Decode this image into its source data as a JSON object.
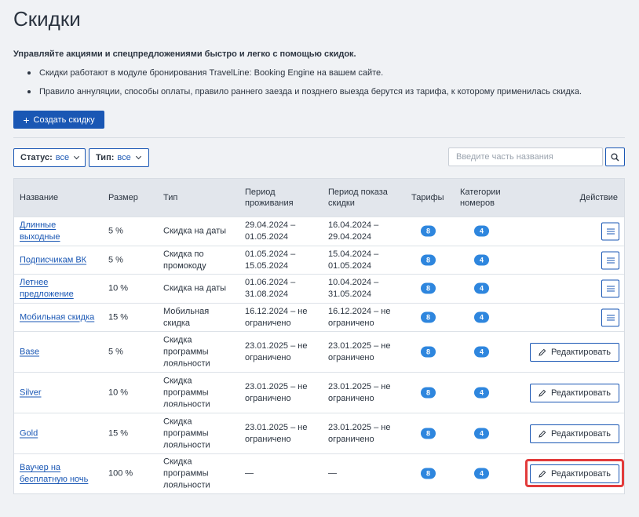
{
  "page": {
    "title": "Скидки",
    "intro": "Управляйте акциями и спецпредложениями быстро и легко с помощью скидок.",
    "bullets": [
      "Скидки работают в модуле бронирования TravelLine: Booking Engine на вашем сайте.",
      "Правило аннуляции, способы оплаты, правило раннего заезда и позднего выезда берутся из тарифа, к которому применилась скидка."
    ],
    "create_button": "Создать скидку"
  },
  "filters": {
    "status_label": "Статус:",
    "status_value": "все",
    "type_label": "Тип:",
    "type_value": "все",
    "search_placeholder": "Введите часть названия"
  },
  "table": {
    "headers": {
      "name": "Название",
      "size": "Размер",
      "type": "Тип",
      "stay_1": "Период",
      "stay_2": "проживания",
      "show_1": "Период показа",
      "show_2": "скидки",
      "rates": "Тарифы",
      "cats_1": "Категории",
      "cats_2": "номеров",
      "action": "Действие"
    },
    "edit_label": "Редактировать",
    "rows": [
      {
        "name_1": "Длинные",
        "name_2": "выходные",
        "size": "5 %",
        "type_1": "Скидка на даты",
        "type_2": "",
        "type_3": "",
        "stay_1": "29.04.2024 –",
        "stay_2": "01.05.2024",
        "show_1": "16.04.2024 –",
        "show_2": "29.04.2024",
        "rates": "8",
        "cats": "4"
      },
      {
        "name_1": "Подписчикам ВК",
        "name_2": "",
        "size": "5 %",
        "type_1": "Скидка по",
        "type_2": "промокоду",
        "type_3": "",
        "stay_1": "01.05.2024 –",
        "stay_2": "15.05.2024",
        "show_1": "15.04.2024 –",
        "show_2": "01.05.2024",
        "rates": "8",
        "cats": "4"
      },
      {
        "name_1": "Летнее",
        "name_2": "предложение",
        "size": "10 %",
        "type_1": "Скидка на даты",
        "type_2": "",
        "type_3": "",
        "stay_1": "01.06.2024 –",
        "stay_2": "31.08.2024",
        "show_1": "10.04.2024 –",
        "show_2": "31.05.2024",
        "rates": "8",
        "cats": "4"
      },
      {
        "name_1": "Мобильная скидка",
        "name_2": "",
        "size": "15 %",
        "type_1": "Мобильная",
        "type_2": "скидка",
        "type_3": "",
        "stay_1": "16.12.2024 – не",
        "stay_2": "ограничено",
        "show_1": "16.12.2024 – не",
        "show_2": "ограничено",
        "rates": "8",
        "cats": "4"
      },
      {
        "name_1": "Base",
        "name_2": "",
        "size": "5 %",
        "type_1": "Скидка",
        "type_2": "программы",
        "type_3": "лояльности",
        "stay_1": "23.01.2025 – не",
        "stay_2": "ограничено",
        "show_1": "23.01.2025 – не",
        "show_2": "ограничено",
        "rates": "8",
        "cats": "4"
      },
      {
        "name_1": "Silver",
        "name_2": "",
        "size": "10 %",
        "type_1": "Скидка",
        "type_2": "программы",
        "type_3": "лояльности",
        "stay_1": "23.01.2025 – не",
        "stay_2": "ограничено",
        "show_1": "23.01.2025 – не",
        "show_2": "ограничено",
        "rates": "8",
        "cats": "4"
      },
      {
        "name_1": "Gold",
        "name_2": "",
        "size": "15 %",
        "type_1": "Скидка",
        "type_2": "программы",
        "type_3": "лояльности",
        "stay_1": "23.01.2025 – не",
        "stay_2": "ограничено",
        "show_1": "23.01.2025 – не",
        "show_2": "ограничено",
        "rates": "8",
        "cats": "4"
      },
      {
        "name_1": "Ваучер на",
        "name_2": "бесплатную ночь",
        "size": "100 %",
        "type_1": "Скидка",
        "type_2": "программы",
        "type_3": "лояльности",
        "stay_1": "—",
        "stay_2": "",
        "show_1": "—",
        "show_2": "",
        "rates": "8",
        "cats": "4"
      }
    ]
  },
  "colors": {
    "accent": "#1a57b4",
    "badge": "#2e86de",
    "highlight": "#e23b3b",
    "page_bg": "#f0f2f5",
    "header_bg": "#e2e6ec"
  }
}
